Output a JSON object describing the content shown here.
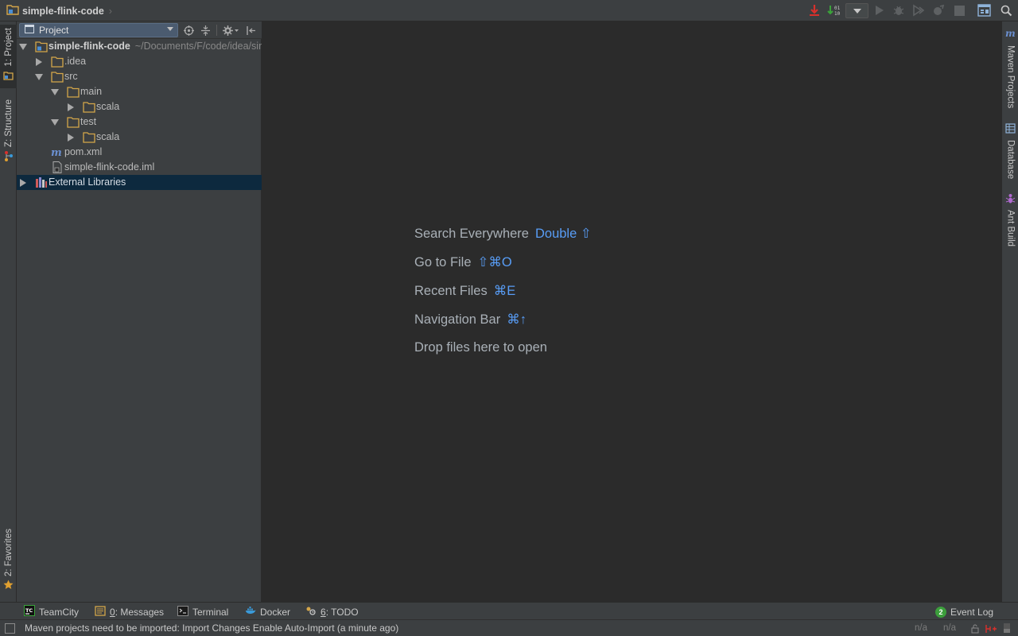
{
  "colors": {
    "accent_key": "#589df6",
    "selected_row": "#0d293e",
    "panel_bg": "#3c3f41",
    "editor_bg": "#2b2b2b",
    "folder": "#d4a64a",
    "event_badge": "#3c9e3c"
  },
  "navbar": {
    "project_name": "simple-flink-code",
    "separator": "›"
  },
  "toolbar": {
    "icons": [
      "download-icon",
      "vcs-update-icon",
      "run-config-dropdown",
      "run-icon",
      "debug-icon",
      "coverage-icon",
      "profile-icon",
      "stop-icon",
      "project-structure-icon",
      "search-icon"
    ]
  },
  "left_stripe": {
    "project_tab": "1: Project",
    "structure_tab": "Z: Structure",
    "favorites_tab": "2: Favorites"
  },
  "right_stripe": {
    "maven_tab": "Maven Projects",
    "database_tab": "Database",
    "ant_tab": "Ant Build"
  },
  "project_panel": {
    "view_label": "Project",
    "tree": [
      {
        "label": "simple-flink-code",
        "path": "~/Documents/F/code/idea/simple-flink-code",
        "type": "module"
      },
      {
        "label": ".idea",
        "type": "folder"
      },
      {
        "label": "src",
        "type": "folder"
      },
      {
        "label": "main",
        "type": "folder"
      },
      {
        "label": "scala",
        "type": "folder"
      },
      {
        "label": "test",
        "type": "folder"
      },
      {
        "label": "scala",
        "type": "folder"
      },
      {
        "label": "pom.xml",
        "type": "maven"
      },
      {
        "label": "simple-flink-code.iml",
        "type": "iml"
      },
      {
        "label": "External Libraries",
        "type": "libraries"
      }
    ]
  },
  "editor_hints": [
    {
      "label": "Search Everywhere",
      "key": "Double ⇧"
    },
    {
      "label": "Go to File",
      "key": "⇧⌘O"
    },
    {
      "label": "Recent Files",
      "key": "⌘E"
    },
    {
      "label": "Navigation Bar",
      "key": "⌘↑"
    },
    {
      "label": "Drop files here to open",
      "key": ""
    }
  ],
  "bottom_tabs": {
    "teamcity": "TeamCity",
    "messages_num": "0",
    "messages": ": Messages",
    "terminal": "Terminal",
    "docker": "Docker",
    "todo_num": "6",
    "todo": ": TODO",
    "event_count": "2",
    "event_log": "Event Log"
  },
  "status": {
    "message": "Maven projects need to be imported: Import Changes Enable Auto-Import (a minute ago)",
    "pos1": "n/a",
    "pos2": "n/a"
  }
}
